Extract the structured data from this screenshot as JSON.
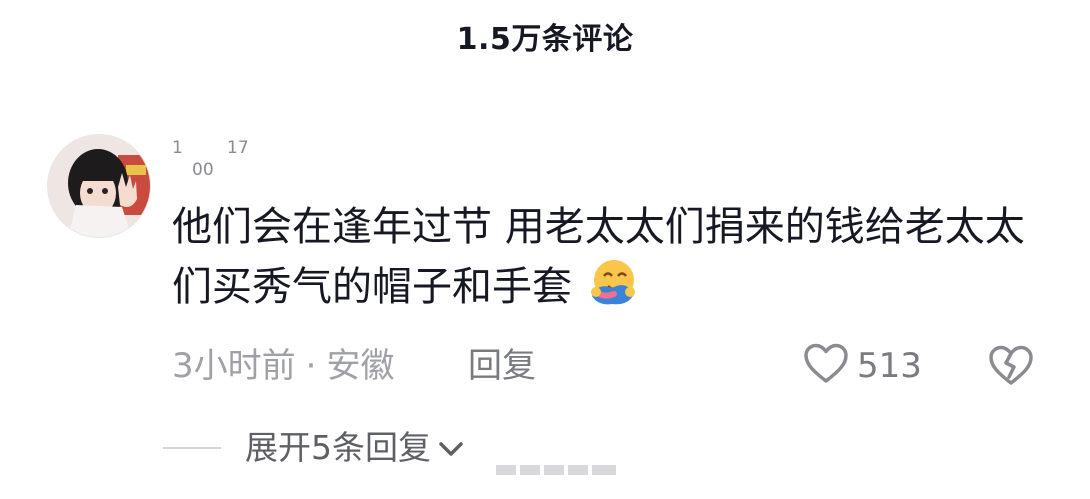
{
  "header": {
    "title": "1.5万条评论"
  },
  "comment": {
    "username_parts": [
      "1",
      "00",
      "17"
    ],
    "text": "他们会在逢年过节 用老太太们捐来的钱给老太太们买秀气的帽子和手套",
    "emoji_icon": "hugging-face-icon",
    "meta": {
      "time": "3小时前",
      "separator": "·",
      "location": "安徽"
    },
    "reply_label": "回复",
    "like_count": "513",
    "expand_label": "展开5条回复"
  },
  "colors": {
    "text_primary": "#161823",
    "text_secondary": "#8a8b91",
    "divider": "#d3d4d8"
  }
}
